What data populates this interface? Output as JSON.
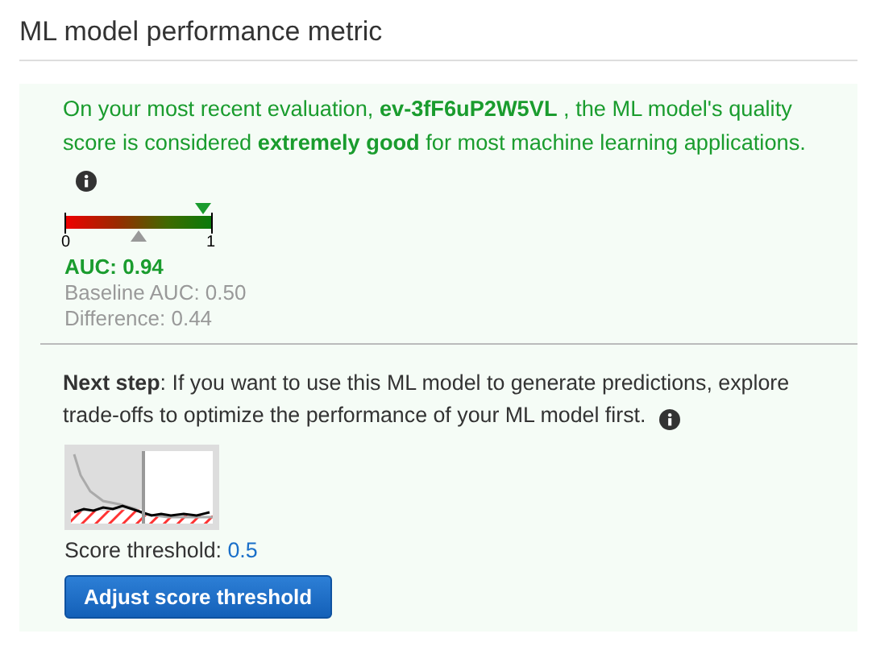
{
  "title": "ML model performance metric",
  "summary": {
    "text": "On your most recent evaluation, **ev-3fF6uP2W5VL** , the ML model's quality score is considered **extremely good** for most machine learning applications.",
    "meter": {
      "min_label": "0",
      "max_label": "1",
      "auc_marker": {
        "level": 0.94
      },
      "baseline_marker": {
        "level": 0.5
      }
    },
    "auc": "AUC: 0.94",
    "baseline": "Baseline AUC: 0.50",
    "difference": "Difference: 0.44"
  },
  "next_step": {
    "text": "**Next step**: If you want to use this ML model to generate predictions, explore trade-offs to optimize the performance of your ML model first.",
    "threshold_label": "Score threshold:",
    "threshold_value": "0.5",
    "button": "Adjust score threshold"
  }
}
